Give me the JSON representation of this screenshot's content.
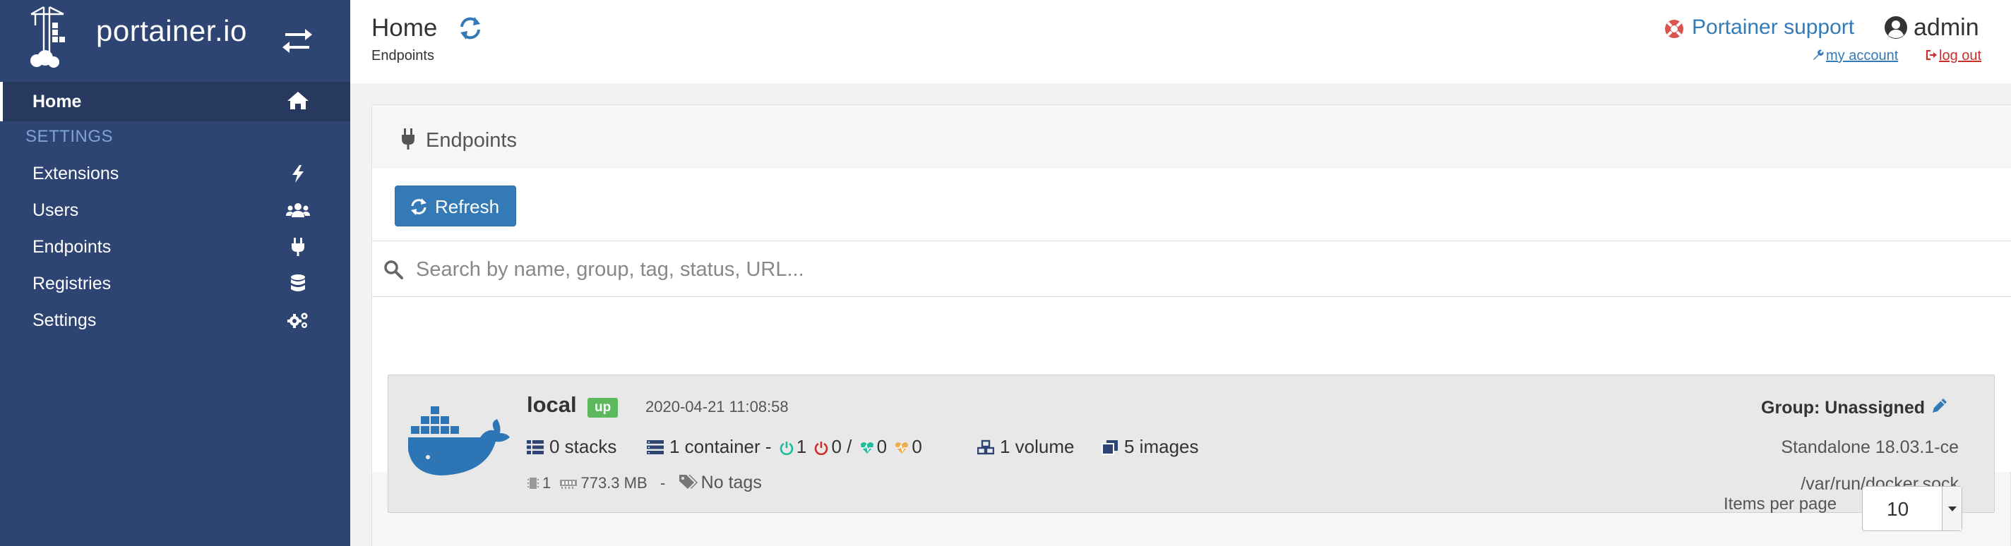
{
  "colors": {
    "sidebar_bg": "#2e4473",
    "sidebar_active_bg": "#27395f",
    "accent_blue": "#337ab7",
    "status_up": "#5cb85c",
    "danger": "#c9302c",
    "healthy": "#1abc9c",
    "unhealthy": "#f0ad4e"
  },
  "sidebar": {
    "brand_text": "portainer.io",
    "toggle_icon": "arrows-exchange-icon",
    "home": {
      "label": "Home",
      "icon": "home-icon"
    },
    "settings_heading": "SETTINGS",
    "items": [
      {
        "label": "Extensions",
        "icon": "bolt-icon"
      },
      {
        "label": "Users",
        "icon": "users-icon"
      },
      {
        "label": "Endpoints",
        "icon": "plug-icon"
      },
      {
        "label": "Registries",
        "icon": "database-icon"
      },
      {
        "label": "Settings",
        "icon": "cogs-icon"
      }
    ]
  },
  "header": {
    "title": "Home",
    "breadcrumb": "Endpoints",
    "support_label": "Portainer support",
    "username": "admin",
    "my_account_label": "my account",
    "logout_label": "log out"
  },
  "panel": {
    "title": "Endpoints",
    "refresh_label": "Refresh",
    "search_placeholder": "Search by name, group, tag, status, URL..."
  },
  "endpoint": {
    "name": "local",
    "status": "up",
    "timestamp": "2020-04-21 11:08:58",
    "stacks": "0 stacks",
    "containers": "1 container -",
    "running": "1",
    "stopped": "0 /",
    "healthy": "0",
    "unhealthy": "0",
    "volumes": "1 volume",
    "images": "5 images",
    "cpu": "1",
    "memory": "773.3 MB",
    "separator": "-",
    "tags": "No tags",
    "group": "Group: Unassigned",
    "type": "Standalone 18.03.1-ce",
    "url": "/var/run/docker.sock"
  },
  "pagination": {
    "items_per_page_label": "Items per page",
    "items_per_page_value": "10"
  }
}
